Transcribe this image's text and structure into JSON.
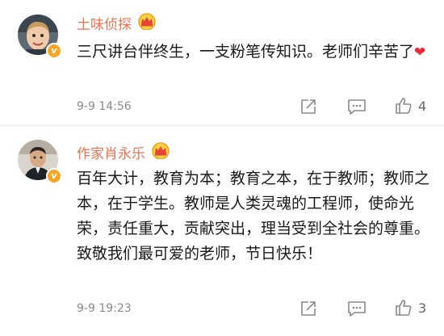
{
  "comments": [
    {
      "username": "土味侦探",
      "text": "三尺讲台伴终生，一支粉笔传知识。老师们辛苦了",
      "timestamp": "9-9 14:56",
      "like_count": "4",
      "avatar_icon": "boy-portrait-avatar",
      "badge_icon": "crown-vip-icon"
    },
    {
      "username": "作家肖永乐",
      "text": "百年大计，教育为本；教育之本，在于教师；教师之本，在于学生。教师是人类灵魂的工程师，使命光荣，责任重大，贡献突出，理当受到全社会的尊重。致敬我们最可爱的老师，节日快乐！",
      "timestamp": "9-9 19:23",
      "like_count": "3",
      "avatar_icon": "man-portrait-avatar",
      "badge_icon": "crown-vip-icon"
    }
  ],
  "colors": {
    "username": "#eb7350",
    "verified_badge": "#f5a623",
    "heart": "#e8283c",
    "timestamp": "#8a8a8a",
    "icon": "#8a8a8a"
  }
}
